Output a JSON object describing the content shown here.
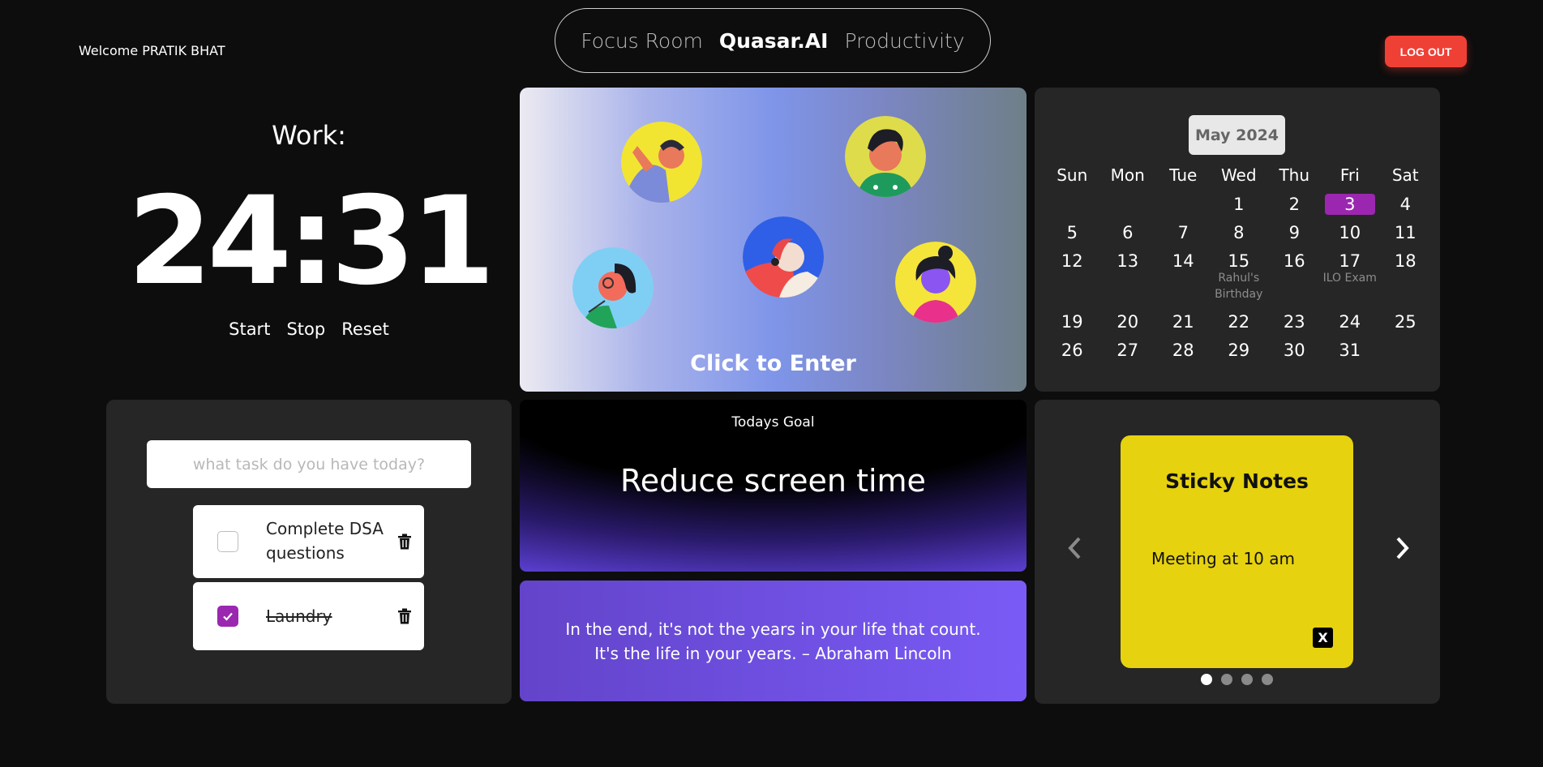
{
  "header": {
    "welcome": "Welcome PRATIK BHAT",
    "nav": {
      "left": "Focus Room",
      "brand": "Quasar.AI",
      "right": "Productivity"
    },
    "logout": "LOG OUT"
  },
  "timer": {
    "label": "Work:",
    "time": "24:31",
    "start": "Start",
    "stop": "Stop",
    "reset": "Reset"
  },
  "focus_room": {
    "cta": "Click to Enter"
  },
  "calendar": {
    "month": "May 2024",
    "weekdays": [
      "Sun",
      "Mon",
      "Tue",
      "Wed",
      "Thu",
      "Fri",
      "Sat"
    ],
    "today": "3",
    "weeks": [
      [
        "",
        "",
        "",
        "1",
        "2",
        "3",
        "4"
      ],
      [
        "5",
        "6",
        "7",
        "8",
        "9",
        "10",
        "11"
      ],
      [
        "12",
        "13",
        "14",
        "15",
        "16",
        "17",
        "18"
      ],
      [
        "19",
        "20",
        "21",
        "22",
        "23",
        "24",
        "25"
      ],
      [
        "26",
        "27",
        "28",
        "29",
        "30",
        "31",
        ""
      ]
    ],
    "events": {
      "15": "Rahul's Birthday",
      "17": "ILO Exam"
    }
  },
  "todo": {
    "placeholder": "what task do you have today?",
    "tasks": [
      {
        "text": "Complete DSA questions",
        "done": false
      },
      {
        "text": "Laundry",
        "done": true
      }
    ]
  },
  "goal": {
    "heading": "Todays Goal",
    "text": "Reduce screen time"
  },
  "quote": {
    "line1": "In the end, it's not the years in your life that count.",
    "line2": "It's the life in your years. – Abraham Lincoln"
  },
  "sticky_notes": {
    "title": "Sticky Notes",
    "body": "Meeting at 10 am",
    "close": "X",
    "pages": 4,
    "active_page": 1
  },
  "colors": {
    "accent_purple": "#9b27b0",
    "logout_red": "#ef4036",
    "sticky_yellow": "#e6d20f"
  }
}
